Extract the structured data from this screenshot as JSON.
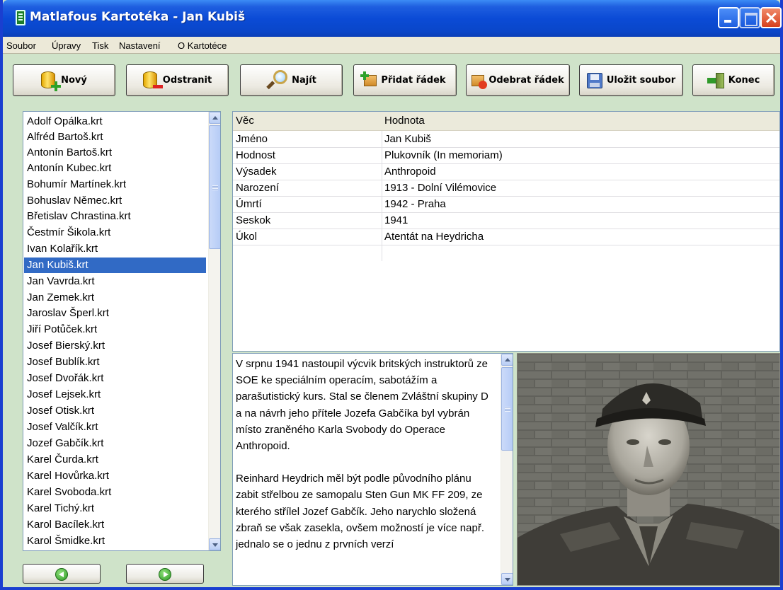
{
  "window": {
    "title": "Matlafous Kartotéka - Jan Kubiš",
    "title_icon": "card-file-icon"
  },
  "menu": {
    "items": [
      "Soubor",
      "Úpravy",
      "Tisk",
      "Nastavení",
      "O Kartotéce"
    ]
  },
  "toolbar": {
    "new_label": "Nový",
    "remove_label": "Odstranit",
    "find_label": "Najít",
    "add_row_label": "Přidat řádek",
    "remove_row_label": "Odebrat řádek",
    "save_label": "Uložit soubor",
    "exit_label": "Konec"
  },
  "file_list": {
    "selected": "Jan Kubiš.krt",
    "items": [
      "Adolf Opálka.krt",
      "Alfréd Bartoš.krt",
      "Antonín Bartoš.krt",
      "Antonín Kubec.krt",
      "Bohumír Martínek.krt",
      "Bohuslav Němec.krt",
      "Břetislav Chrastina.krt",
      "Čestmír Šikola.krt",
      "Ivan Kolařík.krt",
      "Jan Kubiš.krt",
      "Jan Vavrda.krt",
      "Jan Zemek.krt",
      "Jaroslav Šperl.krt",
      "Jiří Potůček.krt",
      "Josef Bierský.krt",
      "Josef Bublík.krt",
      "Josef Dvořák.krt",
      "Josef Lejsek.krt",
      "Josef Otisk.krt",
      "Josef Valčík.krt",
      "Jozef Gabčík.krt",
      "Karel Čurda.krt",
      "Karel Hovůrka.krt",
      "Karel Svoboda.krt",
      "Karel Tichý.krt",
      "Karol Bacílek.krt",
      "Karol Šmidke.krt"
    ]
  },
  "grid": {
    "col_key": "Věc",
    "col_value": "Hodnota",
    "rows": [
      {
        "key": "Jméno",
        "value": "Jan Kubiš"
      },
      {
        "key": "Hodnost",
        "value": "Plukovník (In memoriam)"
      },
      {
        "key": "Výsadek",
        "value": "Anthropoid"
      },
      {
        "key": "Narození",
        "value": "1913 - Dolní Vilémovice"
      },
      {
        "key": "Úmrtí",
        "value": "1942 - Praha"
      },
      {
        "key": "Seskok",
        "value": "1941"
      },
      {
        "key": "Úkol",
        "value": "Atentát na Heydricha"
      }
    ]
  },
  "description": {
    "paragraphs": [
      "V srpnu 1941 nastoupil výcvik britských instruktorů ze SOE ke speciálním operacím, sabotážím a parašutistický kurs. Stal se členem Zvláštní skupiny D a na návrh jeho přítele Jozefa Gabčíka byl vybrán místo zraněného Karla Svobody do Operace Anthropoid.",
      "Reinhard Heydrich měl být podle původního plánu zabit střelbou ze samopalu Sten Gun MK FF 209, ze kterého střílel Jozef Gabčík. Jeho narychlo složená zbraň se však zasekla, ovšem možností je více např. jednalo se o jednu z prvních verzí"
    ]
  },
  "colors": {
    "titlebar": "#0a46c9",
    "selection": "#316ac5",
    "window_bg": "#cfe3c9"
  }
}
